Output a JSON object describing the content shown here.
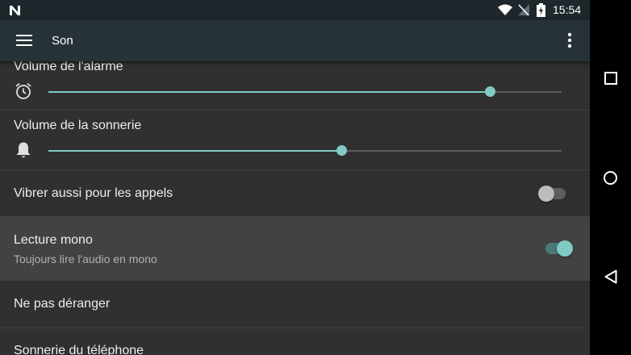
{
  "status_bar": {
    "time": "15:54",
    "notification_icon": "n-notification-icon",
    "wifi_icon": "wifi-icon",
    "signal_icon": "no-signal-icon",
    "battery_icon": "battery-charging-icon"
  },
  "app_bar": {
    "title": "Son",
    "menu_icon": "hamburger-menu-icon",
    "overflow_icon": "more-vert-icon"
  },
  "settings": {
    "alarm_volume": {
      "label": "Volume de l'alarme",
      "icon": "alarm-clock-icon",
      "value_fraction": 0.86
    },
    "ring_volume": {
      "label": "Volume de la sonnerie",
      "icon": "bell-icon",
      "value_fraction": 0.57
    },
    "vibrate_calls": {
      "label": "Vibrer aussi pour les appels",
      "enabled": false
    },
    "mono_audio": {
      "label": "Lecture mono",
      "summary": "Toujours lire l'audio en mono",
      "enabled": true
    },
    "do_not_disturb": {
      "label": "Ne pas déranger"
    },
    "phone_ringtone": {
      "label": "Sonnerie du téléphone"
    }
  },
  "colors": {
    "accent": "#80cbc4",
    "app_bar": "#263238",
    "background": "#303030",
    "highlight_row": "#424242"
  },
  "nav_bar": {
    "recents_icon": "square-recents-icon",
    "home_icon": "circle-home-icon",
    "back_icon": "triangle-back-icon"
  }
}
